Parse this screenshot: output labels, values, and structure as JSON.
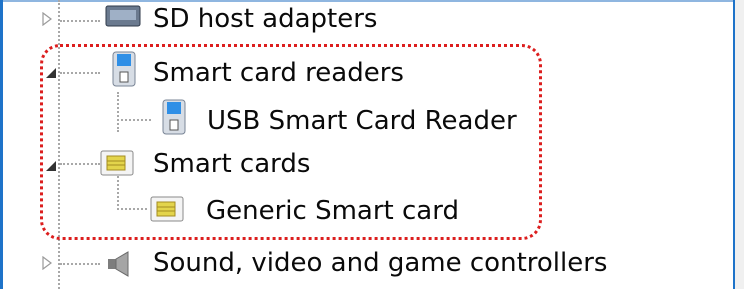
{
  "tree": {
    "items": [
      {
        "label": "SD host adapters",
        "expanded": false,
        "icon": "sd-adapter-icon"
      },
      {
        "label": "Smart card readers",
        "expanded": true,
        "icon": "smart-card-reader-icon"
      },
      {
        "label": "USB Smart Card Reader",
        "icon": "smart-card-reader-icon"
      },
      {
        "label": "Smart cards",
        "expanded": true,
        "icon": "smart-card-icon"
      },
      {
        "label": "Generic Smart card",
        "icon": "smart-card-icon"
      },
      {
        "label": "Sound, video and game controllers",
        "expanded": false,
        "icon": "speaker-icon"
      }
    ]
  },
  "colors": {
    "highlight": "#dc1e1e",
    "window_border": "#1e73c9",
    "tree_lines": "#a8a8a8"
  }
}
